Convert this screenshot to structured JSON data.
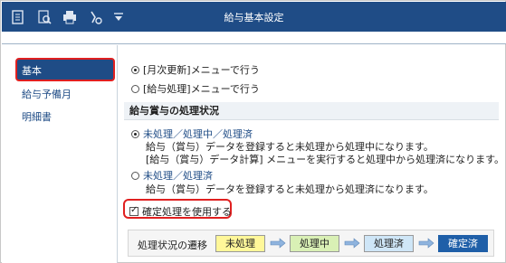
{
  "window": {
    "title": "給与基本設定"
  },
  "toolbar": {
    "icons": [
      "document-icon",
      "search-icon",
      "printer-icon",
      "tool-icon",
      "chevron-down-icon"
    ]
  },
  "sidebar": {
    "items": [
      {
        "label": "基本",
        "active": true
      },
      {
        "label": "給与予備月",
        "active": false
      },
      {
        "label": "明細書",
        "active": false
      }
    ]
  },
  "update_mode": {
    "options": [
      {
        "label": "[月次更新]メニューで行う",
        "selected": true
      },
      {
        "label": "[給与処理]メニューで行う",
        "selected": false
      }
    ]
  },
  "status_section": {
    "heading": "給与賞与の処理状況",
    "options": [
      {
        "label": "未処理／処理中／処理済",
        "selected": true,
        "desc1": "給与（賞与）データを登録すると未処理から処理中になります。",
        "desc2": "[給与（賞与）データ計算] メニューを実行すると処理中から処理済になります。"
      },
      {
        "label": "未処理／処理済",
        "selected": false,
        "desc1": "給与（賞与）データを登録すると未処理から処理済になります。"
      }
    ]
  },
  "confirm": {
    "label": "確定処理を使用する",
    "checked": true
  },
  "flow": {
    "label": "処理状況の遷移",
    "steps": [
      {
        "label": "未処理",
        "color": "#fff799"
      },
      {
        "label": "処理中",
        "color": "#d9f0b5"
      },
      {
        "label": "処理済",
        "color": "#cfe6f7"
      },
      {
        "label": "確定済",
        "color": "#1f5fa8"
      }
    ]
  },
  "colors": {
    "accent": "#1f4c86",
    "highlight": "#e02020"
  }
}
